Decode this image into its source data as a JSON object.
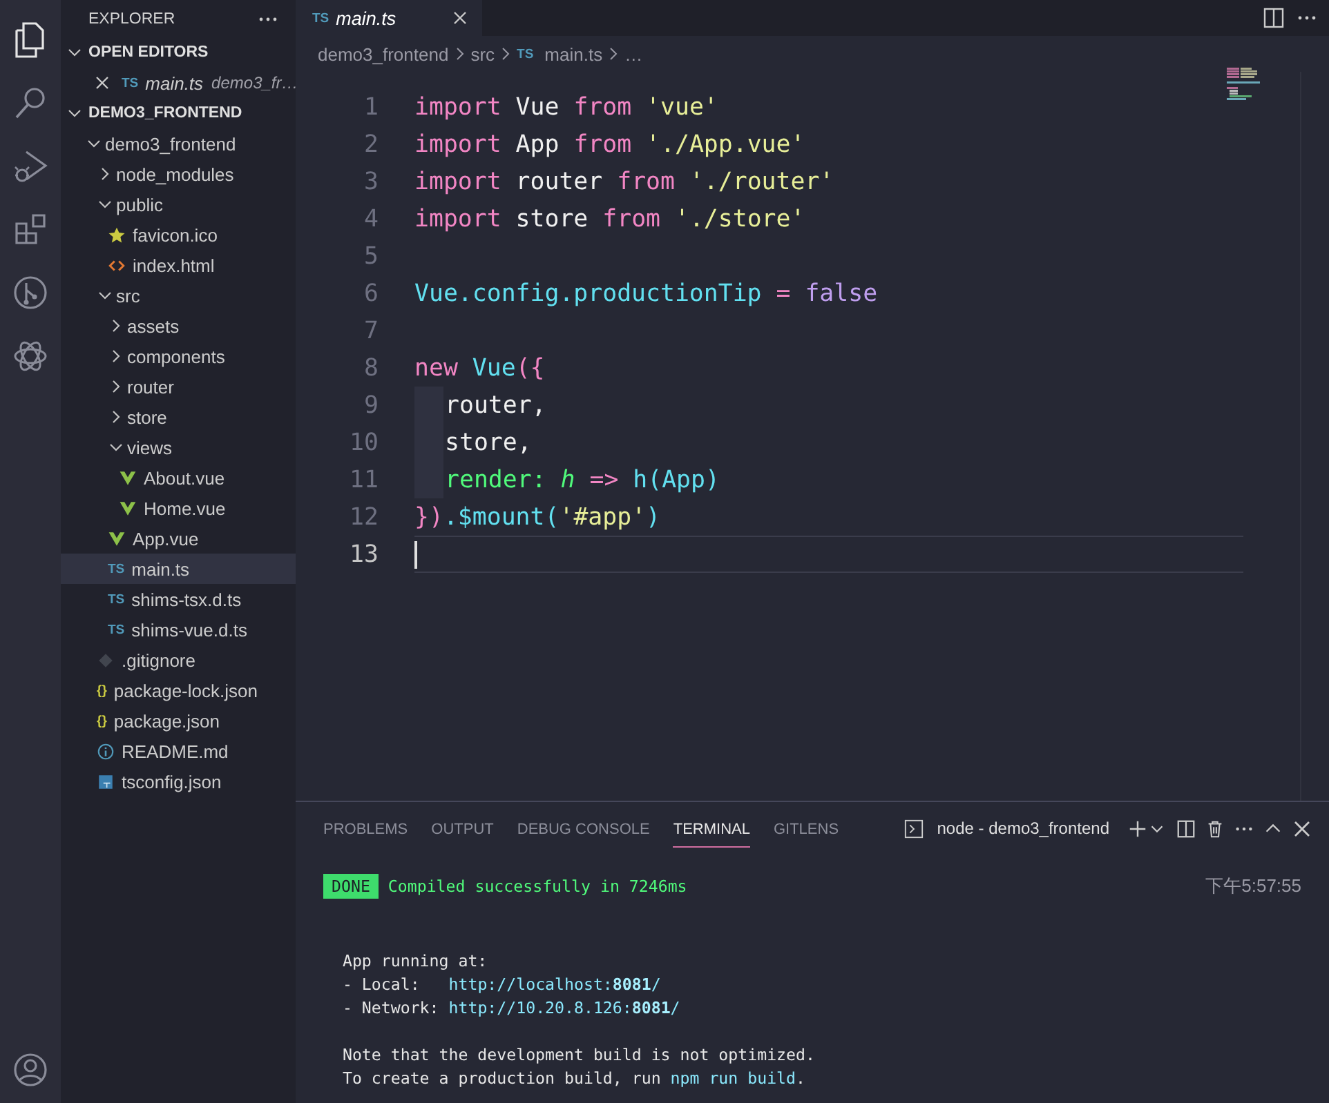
{
  "activity_bar": {
    "items": [
      {
        "kind": "files",
        "selected": true
      },
      {
        "kind": "search",
        "selected": false
      },
      {
        "kind": "debug",
        "selected": false
      },
      {
        "kind": "extensions",
        "selected": false
      },
      {
        "kind": "git",
        "selected": false
      },
      {
        "kind": "ai",
        "selected": false
      }
    ],
    "bottom": [
      {
        "kind": "account",
        "selected": false
      }
    ]
  },
  "sidebar": {
    "title": "EXPLORER",
    "open_editors": {
      "title": "OPEN EDITORS",
      "expanded": true,
      "items": [
        {
          "name": "main.ts",
          "description": "demo3_fr…",
          "badge": "TS",
          "kind": "ts",
          "preview": true,
          "selected": false
        }
      ]
    },
    "workspace": {
      "title": "DEMO3_FRONTEND",
      "expanded": true,
      "tree": [
        {
          "name": "demo3_frontend",
          "kind": "folder",
          "expanded": true,
          "selected": false,
          "children": [
            {
              "name": "node_modules",
              "kind": "folder",
              "expanded": false,
              "selected": false
            },
            {
              "name": "public",
              "kind": "folder",
              "expanded": true,
              "selected": false,
              "children": [
                {
                  "name": "favicon.ico",
                  "kind": "star",
                  "selected": false
                },
                {
                  "name": "index.html",
                  "kind": "html",
                  "selected": false
                }
              ]
            },
            {
              "name": "src",
              "kind": "folder",
              "expanded": true,
              "selected": false,
              "children": [
                {
                  "name": "assets",
                  "kind": "folder",
                  "expanded": false,
                  "selected": false
                },
                {
                  "name": "components",
                  "kind": "folder",
                  "expanded": false,
                  "selected": false
                },
                {
                  "name": "router",
                  "kind": "folder",
                  "expanded": false,
                  "selected": false
                },
                {
                  "name": "store",
                  "kind": "folder",
                  "expanded": false,
                  "selected": false
                },
                {
                  "name": "views",
                  "kind": "folder",
                  "expanded": true,
                  "selected": false,
                  "children": [
                    {
                      "name": "About.vue",
                      "kind": "vue",
                      "selected": false
                    },
                    {
                      "name": "Home.vue",
                      "kind": "vue",
                      "selected": false
                    }
                  ]
                },
                {
                  "name": "App.vue",
                  "kind": "vue",
                  "selected": false
                },
                {
                  "name": "main.ts",
                  "kind": "ts",
                  "badge": "TS",
                  "selected": true
                },
                {
                  "name": "shims-tsx.d.ts",
                  "kind": "ts",
                  "badge": "TS",
                  "selected": false
                },
                {
                  "name": "shims-vue.d.ts",
                  "kind": "ts",
                  "badge": "TS",
                  "selected": false
                }
              ]
            },
            {
              "name": ".gitignore",
              "kind": "git",
              "selected": false
            },
            {
              "name": "package-lock.json",
              "kind": "json",
              "badge": "{}",
              "selected": false
            },
            {
              "name": "package.json",
              "kind": "json",
              "badge": "{}",
              "selected": false
            },
            {
              "name": "README.md",
              "kind": "info",
              "selected": false
            },
            {
              "name": "tsconfig.json",
              "kind": "tsconfig",
              "selected": false
            }
          ]
        }
      ]
    }
  },
  "editor": {
    "tabs": [
      {
        "label": "main.ts",
        "kind": "ts",
        "badge": "TS",
        "preview": true,
        "selected": true
      }
    ],
    "breadcrumb": [
      {
        "label": "demo3_frontend"
      },
      {
        "label": "src"
      },
      {
        "label": "main.ts",
        "kind": "ts",
        "badge": "TS"
      },
      {
        "label": "…"
      }
    ],
    "lines": [
      {
        "number": "1",
        "active": false,
        "indent_guide": false,
        "tokens": [
          {
            "text": "import",
            "kind": "keyword"
          },
          {
            "text": " Vue ",
            "kind": "ident"
          },
          {
            "text": "from",
            "kind": "keyword"
          },
          {
            "text": " 'vue'",
            "kind": "string"
          }
        ]
      },
      {
        "number": "2",
        "active": false,
        "indent_guide": false,
        "tokens": [
          {
            "text": "import",
            "kind": "keyword"
          },
          {
            "text": " App ",
            "kind": "ident"
          },
          {
            "text": "from",
            "kind": "keyword"
          },
          {
            "text": " './App.vue'",
            "kind": "string"
          }
        ]
      },
      {
        "number": "3",
        "active": false,
        "indent_guide": false,
        "tokens": [
          {
            "text": "import",
            "kind": "keyword"
          },
          {
            "text": " router ",
            "kind": "ident"
          },
          {
            "text": "from",
            "kind": "keyword"
          },
          {
            "text": " './router'",
            "kind": "string"
          }
        ]
      },
      {
        "number": "4",
        "active": false,
        "indent_guide": false,
        "tokens": [
          {
            "text": "import",
            "kind": "keyword"
          },
          {
            "text": " store ",
            "kind": "ident"
          },
          {
            "text": "from",
            "kind": "keyword"
          },
          {
            "text": " './store'",
            "kind": "string"
          }
        ]
      },
      {
        "number": "5",
        "active": false,
        "indent_guide": false
      },
      {
        "number": "6",
        "active": false,
        "indent_guide": false,
        "tokens": [
          {
            "text": "Vue.config.productionTip",
            "kind": "prop"
          },
          {
            "text": " = ",
            "kind": "keyword"
          },
          {
            "text": "false",
            "kind": "bool"
          }
        ]
      },
      {
        "number": "7",
        "active": false,
        "indent_guide": false
      },
      {
        "number": "8",
        "active": false,
        "indent_guide": false,
        "tokens": [
          {
            "text": "new",
            "kind": "keyword"
          },
          {
            "text": " Vue",
            "kind": "prop"
          },
          {
            "text": "({",
            "kind": "keyword"
          }
        ]
      },
      {
        "number": "9",
        "active": false,
        "indent_guide": true,
        "tokens": [
          {
            "text": "router,",
            "kind": "ident"
          }
        ]
      },
      {
        "number": "10",
        "active": false,
        "indent_guide": true,
        "tokens": [
          {
            "text": "store,",
            "kind": "ident"
          }
        ]
      },
      {
        "number": "11",
        "active": false,
        "indent_guide": true,
        "tokens": [
          {
            "text": "render:",
            "kind": "key"
          },
          {
            "text": " h",
            "kind": "param"
          },
          {
            "text": " => ",
            "kind": "keyword"
          },
          {
            "text": "h(App)",
            "kind": "prop"
          }
        ]
      },
      {
        "number": "12",
        "active": false,
        "indent_guide": false,
        "tokens": [
          {
            "text": "})",
            "kind": "keyword"
          },
          {
            "text": ".$mount(",
            "kind": "prop"
          },
          {
            "text": "'#app'",
            "kind": "string"
          },
          {
            "text": ")",
            "kind": "prop"
          }
        ]
      },
      {
        "number": "13",
        "active": true,
        "indent_guide": false
      }
    ]
  },
  "panel": {
    "tabs": [
      {
        "label": "PROBLEMS",
        "selected": false
      },
      {
        "label": "OUTPUT",
        "selected": false
      },
      {
        "label": "DEBUG CONSOLE",
        "selected": false
      },
      {
        "label": "TERMINAL",
        "selected": true
      },
      {
        "label": "GITLENS",
        "selected": false
      }
    ],
    "terminal_name": "node - demo3_frontend",
    "timestamp": "下午5:57:55",
    "blocks": [
      [
        {
          "spans": [
            {
              "text": "DONE",
              "kind": "badge"
            },
            {
              "text": " Compiled successfully in 7246ms",
              "kind": "success"
            }
          ]
        }
      ],
      [
        {
          "spans": [
            {
              "text": "  App running at:",
              "kind": "plain"
            }
          ]
        },
        {
          "spans": [
            {
              "text": "  - Local:   ",
              "kind": "plain"
            },
            {
              "text": "http://localhost:",
              "kind": "link"
            },
            {
              "text": "8081",
              "kind": "link-bold"
            },
            {
              "text": "/",
              "kind": "link"
            }
          ]
        },
        {
          "spans": [
            {
              "text": "  - Network: ",
              "kind": "plain"
            },
            {
              "text": "http://10.20.8.126:",
              "kind": "link"
            },
            {
              "text": "8081",
              "kind": "link-bold"
            },
            {
              "text": "/",
              "kind": "link"
            }
          ]
        }
      ],
      [
        {
          "spans": [
            {
              "text": "  Note that the development build is not optimized.",
              "kind": "plain"
            }
          ]
        },
        {
          "spans": [
            {
              "text": "  To create a production build, run ",
              "kind": "plain"
            },
            {
              "text": "npm run build",
              "kind": "link"
            },
            {
              "text": ".",
              "kind": "plain"
            }
          ]
        }
      ]
    ]
  }
}
